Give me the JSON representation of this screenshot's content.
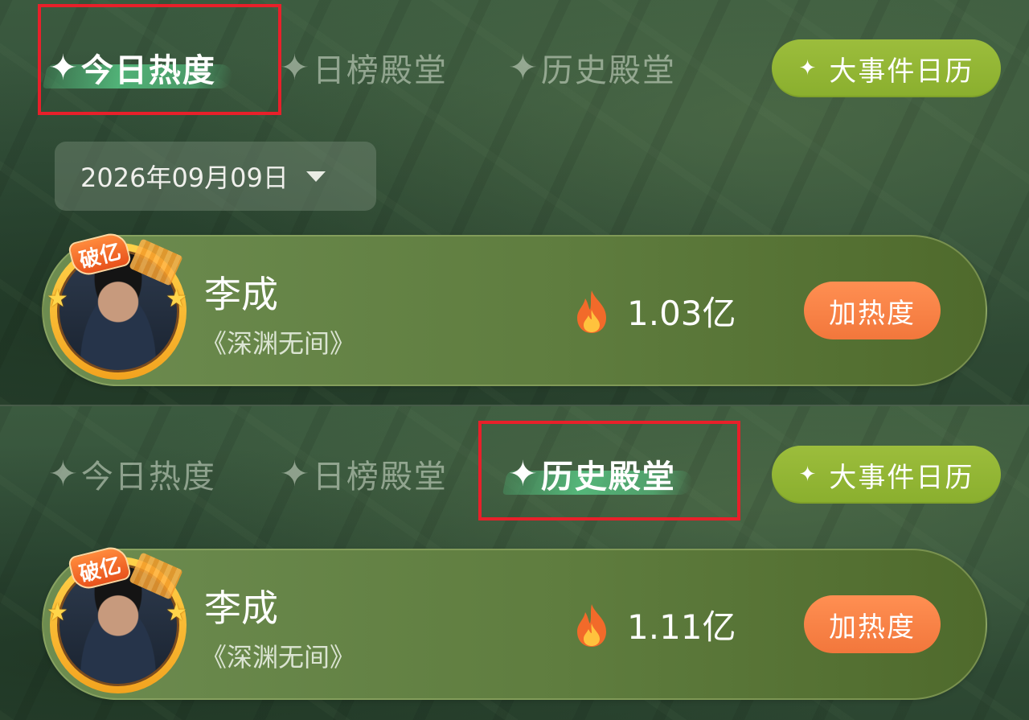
{
  "top": {
    "tabs": [
      {
        "label": "今日热度",
        "active": true
      },
      {
        "label": "日榜殿堂",
        "active": false
      },
      {
        "label": "历史殿堂",
        "active": false
      }
    ],
    "calendar_button": "大事件日历",
    "date": "2026年09月09日",
    "card": {
      "badge": "破亿",
      "name": "李成",
      "show": "《深渊无间》",
      "heat": "1.03亿",
      "button": "加热度"
    }
  },
  "bottom": {
    "tabs": [
      {
        "label": "今日热度",
        "active": false
      },
      {
        "label": "日榜殿堂",
        "active": false
      },
      {
        "label": "历史殿堂",
        "active": true
      }
    ],
    "calendar_button": "大事件日历",
    "card": {
      "badge": "破亿",
      "name": "李成",
      "show": "《深渊无间》",
      "heat": "1.11亿",
      "button": "加热度"
    }
  },
  "star_glyph": "✦",
  "colors": {
    "highlight_box": "#e8202a",
    "calendar_button": "#9cbd3c",
    "add_heat_button": "#f2773c",
    "avatar_ring": "#f3a31f"
  },
  "icons": [
    "sparkle-icon",
    "caret-down-icon",
    "flame-icon",
    "star-icon"
  ]
}
